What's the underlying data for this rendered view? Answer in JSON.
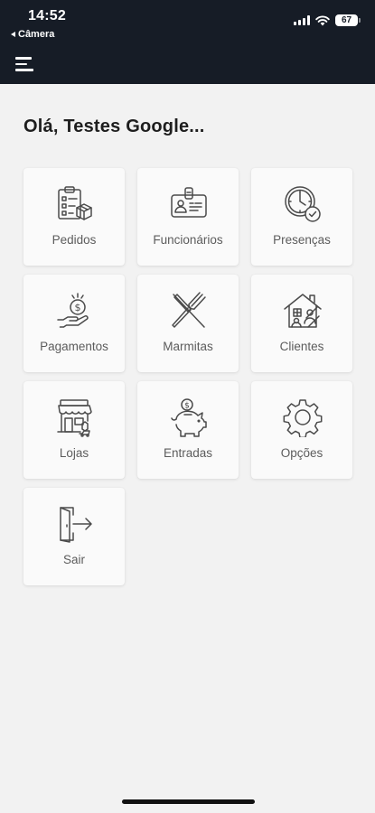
{
  "status_bar": {
    "time": "14:52",
    "back_app": "Câmera",
    "battery": "67"
  },
  "header": {
    "background_color": "#161c26",
    "menu_icon": "hamburger-menu-icon"
  },
  "greeting": "Olá, Testes Google...",
  "tiles": [
    {
      "label": "Pedidos",
      "icon": "clipboard-box-icon"
    },
    {
      "label": "Funcionários",
      "icon": "id-badge-icon"
    },
    {
      "label": "Presenças",
      "icon": "clock-check-icon"
    },
    {
      "label": "Pagamentos",
      "icon": "hand-coin-icon"
    },
    {
      "label": "Marmitas",
      "icon": "fork-knife-icon"
    },
    {
      "label": "Clientes",
      "icon": "house-people-icon"
    },
    {
      "label": "Lojas",
      "icon": "storefront-icon"
    },
    {
      "label": "Entradas",
      "icon": "piggy-bank-icon"
    },
    {
      "label": "Opções",
      "icon": "gear-icon"
    },
    {
      "label": "Sair",
      "icon": "door-exit-icon"
    }
  ]
}
